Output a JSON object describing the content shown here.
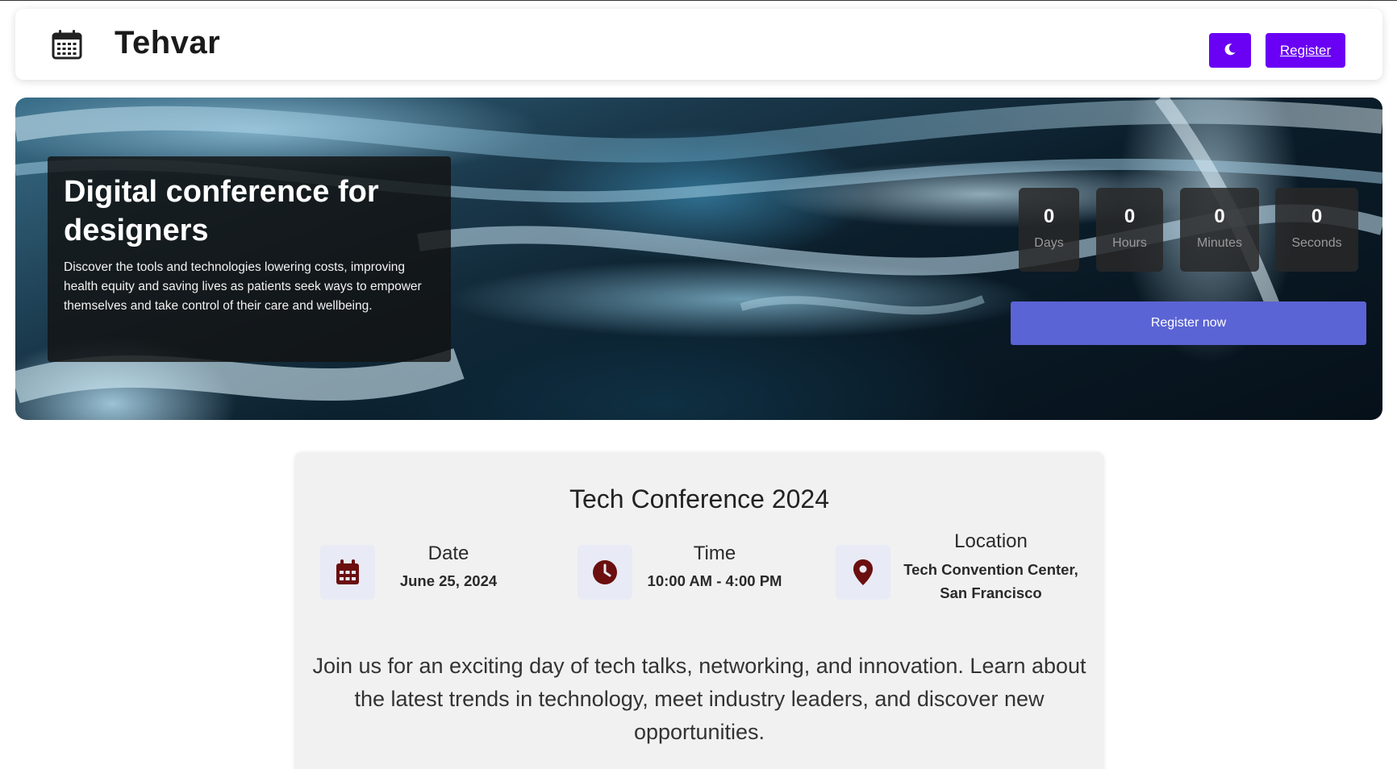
{
  "header": {
    "brand": "Tehvar",
    "logo_icon": "calendar-icon",
    "theme_toggle_icon": "moon-icon",
    "register_label": "Register",
    "accent": "#6a00f4"
  },
  "hero": {
    "title": "Digital conference for designers",
    "description": "Discover the tools and technologies lowering costs, improving health equity and saving lives as patients seek ways to empower themselves and take control of their care and wellbeing.",
    "countdown": [
      {
        "value": "0",
        "label": "Days"
      },
      {
        "value": "0",
        "label": "Hours"
      },
      {
        "value": "0",
        "label": "Minutes"
      },
      {
        "value": "0",
        "label": "Seconds"
      }
    ],
    "register_now_label": "Register now",
    "register_now_color": "#5b64d4"
  },
  "event": {
    "title": "Tech Conference 2024",
    "date": {
      "heading": "Date",
      "value": "June 25, 2024",
      "icon": "calendar-icon"
    },
    "time": {
      "heading": "Time",
      "value": "10:00 AM - 4:00 PM",
      "icon": "clock-icon"
    },
    "location": {
      "heading": "Location",
      "value_line1": "Tech Convention Center,",
      "value_line2": "San Francisco",
      "icon": "map-pin-icon"
    },
    "icon_color": "#6b0f0f",
    "description": "Join us for an exciting day of tech talks, networking, and innovation. Learn about the latest trends in technology, meet industry leaders, and discover new opportunities."
  }
}
